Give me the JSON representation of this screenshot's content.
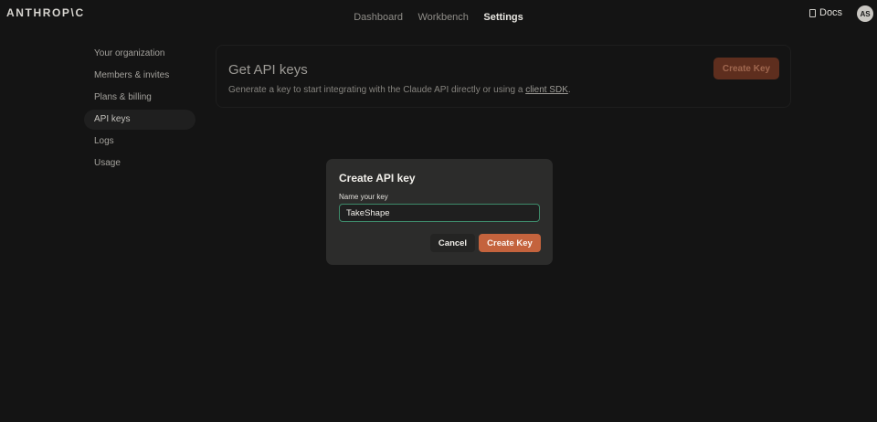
{
  "app": {
    "logo": "ANTHROP\\C"
  },
  "topnav": {
    "items": [
      {
        "label": "Dashboard",
        "active": false
      },
      {
        "label": "Workbench",
        "active": false
      },
      {
        "label": "Settings",
        "active": true
      }
    ]
  },
  "header": {
    "docs_label": "Docs",
    "avatar_initials": "AS"
  },
  "sidebar": {
    "items": [
      {
        "label": "Your organization"
      },
      {
        "label": "Members & invites"
      },
      {
        "label": "Plans & billing"
      },
      {
        "label": "API keys",
        "active": true
      },
      {
        "label": "Logs"
      },
      {
        "label": "Usage"
      }
    ]
  },
  "main": {
    "title": "Get API keys",
    "description_prefix": "Generate a key to start integrating with the Claude API directly or using a ",
    "description_link": "client SDK",
    "description_suffix": ".",
    "create_button": "Create Key"
  },
  "modal": {
    "title": "Create API key",
    "field_label": "Name your key",
    "input_value": "TakeShape",
    "cancel_label": "Cancel",
    "create_label": "Create Key"
  },
  "colors": {
    "accent": "#c4633d",
    "input_focus": "#3e8a6a",
    "background": "#141414"
  }
}
